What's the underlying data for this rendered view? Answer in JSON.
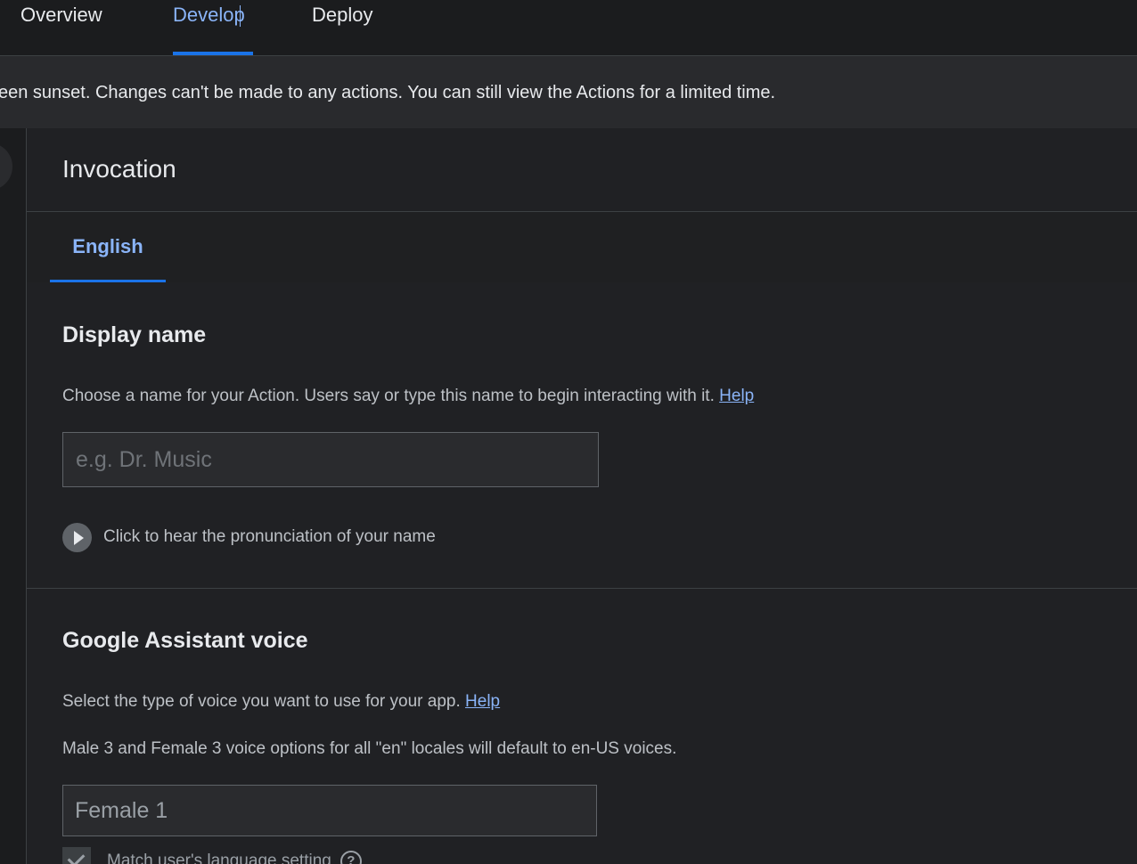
{
  "top_tabs": [
    {
      "label": "Overview"
    },
    {
      "label": "Develop"
    },
    {
      "label": "Deploy"
    }
  ],
  "banner": {
    "text": "een sunset. Changes can't be made to any actions. You can still view the Actions for a limited time."
  },
  "page": {
    "title": "Invocation"
  },
  "lang_tabs": [
    {
      "label": "English"
    }
  ],
  "display_name": {
    "title": "Display name",
    "description": "Choose a name for your Action. Users say or type this name to begin interacting with it.",
    "help_label": "Help",
    "input_placeholder": "e.g. Dr. Music",
    "input_value": "",
    "play_label": "Click to hear the pronunciation of your name"
  },
  "voice": {
    "title": "Google Assistant voice",
    "description": "Select the type of voice you want to use for your app.",
    "help_label": "Help",
    "note": "Male 3 and Female 3 voice options for all \"en\" locales will default to en-US voices.",
    "selected_voice": "Female 1",
    "match_setting_label": "Match user's language setting",
    "match_setting_checked": true
  },
  "colors": {
    "accent": "#8ab4f8",
    "accent_underline": "#1a73e8",
    "background": "#202124"
  }
}
